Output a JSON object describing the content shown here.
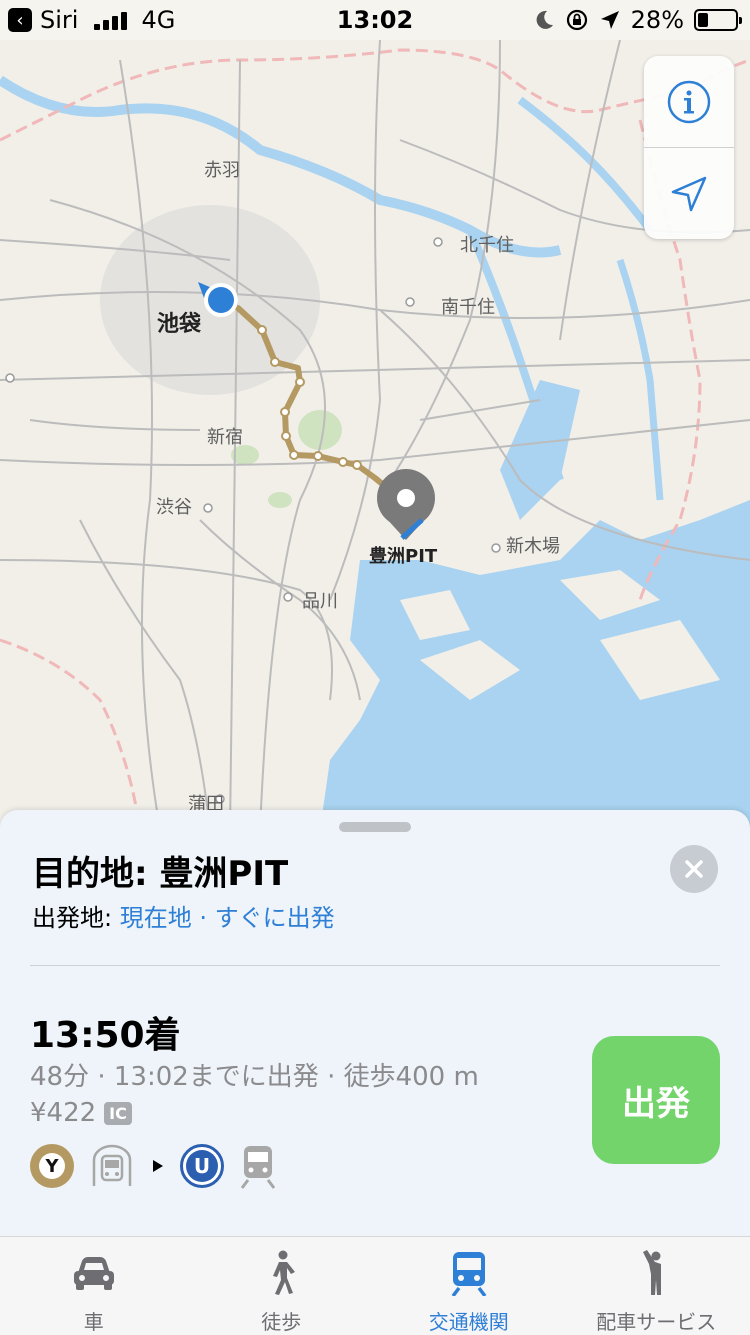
{
  "status_bar": {
    "back_app": "Siri",
    "network": "4G",
    "time": "13:02",
    "battery": "28%",
    "battery_level": 0.28
  },
  "map": {
    "labels": {
      "akabane": "赤羽",
      "kitasenju": "北千住",
      "minamisenju": "南千住",
      "ikebukuro": "池袋",
      "shinjuku": "新宿",
      "shibuya": "渋谷",
      "shinagawa": "品川",
      "shinkiba": "新木場",
      "kamata": "蒲田",
      "destination": "豊洲PIT"
    },
    "colors": {
      "water": "#a9d3f0",
      "land": "#f2efe9",
      "route": "#b49a62",
      "current_location": "#2e7fd6",
      "pin": "#7a7a7a"
    }
  },
  "controls": {
    "info_icon": "info-icon",
    "location_icon": "location-arrow-icon"
  },
  "sheet": {
    "title": "目的地: 豊洲PIT",
    "origin_prefix": "出発地: ",
    "origin_value": "現在地",
    "origin_separator": " · ",
    "depart_time": "すぐに出発",
    "arrival": "13:50着",
    "summary": "48分 · 13:02までに出発 · 徒歩400 m",
    "fare": "¥422",
    "fare_badge": "IC",
    "lines": {
      "first_letter": "Y",
      "second_letter": "U"
    },
    "go_button": "出発",
    "colors": {
      "link": "#2e7fd6",
      "go_button": "#73d46c",
      "line_y": "#b49a62",
      "line_u": "#2d5fb0"
    }
  },
  "tabs": [
    {
      "label": "車",
      "icon": "car-icon",
      "active": false
    },
    {
      "label": "徒歩",
      "icon": "walk-icon",
      "active": false
    },
    {
      "label": "交通機関",
      "icon": "transit-icon",
      "active": true
    },
    {
      "label": "配車サービス",
      "icon": "ride-hail-icon",
      "active": false
    }
  ]
}
